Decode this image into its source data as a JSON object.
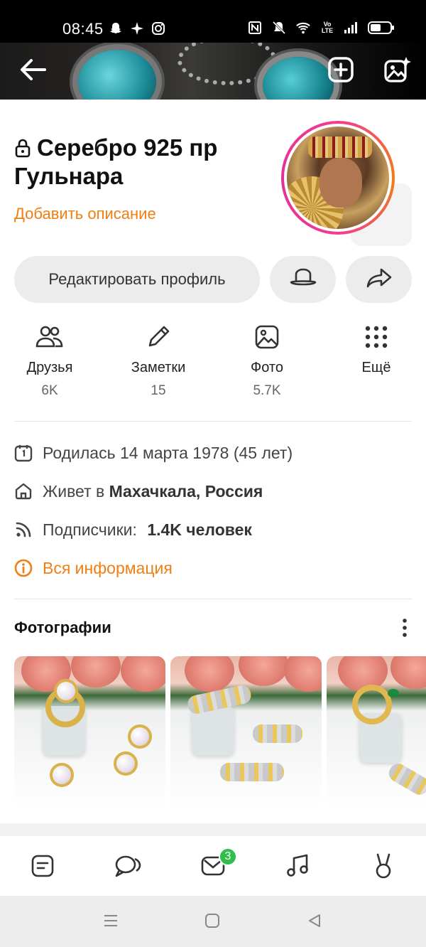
{
  "status_bar": {
    "time": "08:45",
    "left_icons": [
      "snapchat-icon",
      "sparkle-icon",
      "instagram-icon"
    ],
    "right_icons": [
      "nfc-icon",
      "mute-icon",
      "wifi-icon",
      "volte-icon",
      "signal-icon",
      "battery-icon"
    ],
    "volte_text": "Vo LTE"
  },
  "cover": {
    "back_icon": "back-arrow-icon",
    "add_icon": "add-square-icon",
    "add_photo_icon": "add-photo-sparkle-icon"
  },
  "profile": {
    "name": "Серебро 925 пр Гульнара",
    "lock_icon": "lock-icon",
    "add_description": "Добавить описание"
  },
  "actions": {
    "edit_profile": "Редактировать профиль",
    "hat_icon": "hat-icon",
    "share_icon": "share-arrow-icon"
  },
  "quick_menu": [
    {
      "icon": "friends-icon",
      "label": "Друзья",
      "count": "6K"
    },
    {
      "icon": "pencil-icon",
      "label": "Заметки",
      "count": "15"
    },
    {
      "icon": "photo-icon",
      "label": "Фото",
      "count": "5.7K"
    },
    {
      "icon": "grid-dots-icon",
      "label": "Ещё",
      "count": ""
    }
  ],
  "info": {
    "birthday": "Родилась 14 марта 1978 (45 лет)",
    "lives_prefix": "Живет в ",
    "lives_city": "Махачкала, Россия",
    "followers_prefix": "Подписчики: ",
    "followers_value": "1.4K человек",
    "all_info": "Вся информация"
  },
  "photos": {
    "title": "Фотографии",
    "more_icon": "vertical-dots-icon",
    "items": [
      "pearl-jewelry-set",
      "silver-gold-ring-earrings",
      "snake-ring-emerald"
    ]
  },
  "bottom_nav": [
    {
      "icon": "feed-icon"
    },
    {
      "icon": "chat-bubbles-icon"
    },
    {
      "icon": "notifications-envelope-icon",
      "badge": "3"
    },
    {
      "icon": "music-icon"
    },
    {
      "icon": "ok-bunny-icon"
    }
  ],
  "system_nav": [
    "menu-lines-icon",
    "home-square-icon",
    "back-triangle-icon"
  ],
  "colors": {
    "accent": "#f07f13",
    "badge": "#2fbf4a",
    "pill_bg": "#ececec"
  }
}
